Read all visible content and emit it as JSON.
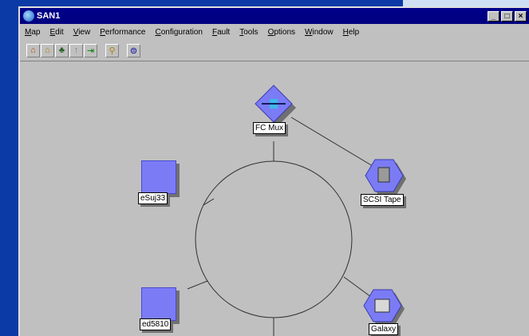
{
  "window": {
    "title": "SAN1",
    "controls": [
      "_",
      "□",
      "×"
    ]
  },
  "menu": [
    "Map",
    "Edit",
    "View",
    "Performance",
    "Configuration",
    "Fault",
    "Tools",
    "Options",
    "Window",
    "Help"
  ],
  "toolbar": {
    "icons": [
      "home-up-icon",
      "home-icon",
      "hierarchy-icon",
      "up-arrow-icon",
      "zoom-fit-icon",
      "search-icon",
      "network-icon"
    ]
  },
  "nodes": {
    "fc_mux": {
      "label": "FC Mux",
      "icon": "hub-icon"
    },
    "scsi_tape": {
      "label": "SCSI Tape",
      "icon": "tape-drive-icon"
    },
    "galaxy": {
      "label": "Galaxy",
      "icon": "storage-icon"
    },
    "sun": {
      "label": "eSuj33",
      "icon": "computer-icon"
    },
    "ed": {
      "label": "ed5810",
      "icon": "computer-icon"
    }
  },
  "colors": {
    "desktop": "#0b3aa6",
    "titlebar": "#000080",
    "node_fill": "#7b7cf5"
  }
}
